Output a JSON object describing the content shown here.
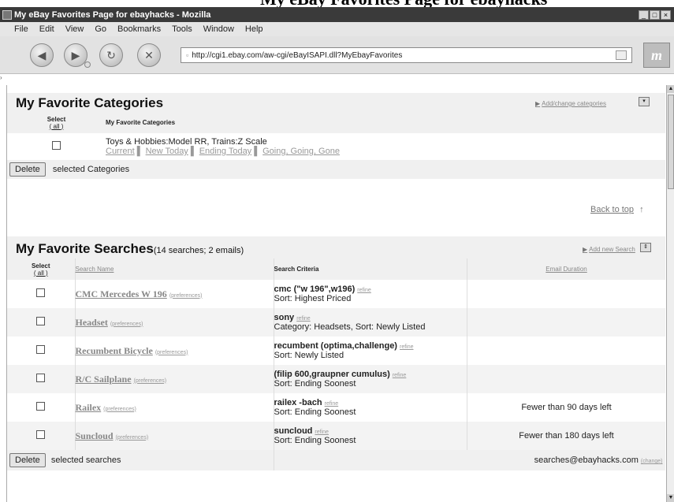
{
  "caption": "My eBay Favorites Page for ebayhacks",
  "window": {
    "title": "My eBay Favorites Page for ebayhacks - Mozilla",
    "controls": [
      "_",
      "□",
      "×"
    ]
  },
  "menu": [
    "File",
    "Edit",
    "View",
    "Go",
    "Bookmarks",
    "Tools",
    "Window",
    "Help"
  ],
  "toolbar": {
    "url": "http://cgi1.ebay.com/aw-cgi/eBayISAPI.dll?MyEbayFavorites",
    "throbber": "m"
  },
  "categories": {
    "title": "My Favorite Categories",
    "add_link": "Add/change categories",
    "select_header": "Select",
    "select_all": "( all )",
    "col_header": "My Favorite Categories",
    "items": [
      {
        "name": "Toys & Hobbies:Model RR, Trains:Z Scale",
        "links": [
          "Current",
          "New Today",
          "Ending Today",
          "Going, Going, Gone"
        ]
      }
    ],
    "delete_label": "Delete",
    "delete_suffix": "selected Categories",
    "back_to_top": "Back to top"
  },
  "searches": {
    "title": "My Favorite Searches",
    "subtitle": "(14 searches; 2 emails)",
    "add_link": "Add new Search",
    "select_header": "Select",
    "select_all": "( all )",
    "col_name": "Search Name",
    "col_criteria": "Search Criteria",
    "col_email": "Email Duration",
    "pref_label": "(preferences)",
    "refine_label": "refine",
    "rows": [
      {
        "name": "CMC Mercedes W 196",
        "query": "cmc (\"w 196\",w196)",
        "sort": "Sort: Highest Priced",
        "email": ""
      },
      {
        "name": "Headset",
        "query": "sony",
        "sort": "Category: Headsets, Sort: Newly Listed",
        "email": ""
      },
      {
        "name": "Recumbent Bicycle",
        "query": "recumbent (optima,challenge)",
        "sort": "Sort: Newly Listed",
        "email": ""
      },
      {
        "name": "R/C Sailplane",
        "query": "(filip 600,graupner cumulus)",
        "sort": "Sort: Ending Soonest",
        "email": ""
      },
      {
        "name": "Railex",
        "query": "railex -bach",
        "sort": "Sort: Ending Soonest",
        "email": "Fewer than 90 days left"
      },
      {
        "name": "Suncloud",
        "query": "suncloud",
        "sort": "Sort: Ending Soonest",
        "email": "Fewer than 180 days left"
      }
    ],
    "delete_label": "Delete",
    "delete_suffix": "selected searches",
    "email_address": "searches@ebayhacks.com",
    "change_label": "(change)"
  }
}
